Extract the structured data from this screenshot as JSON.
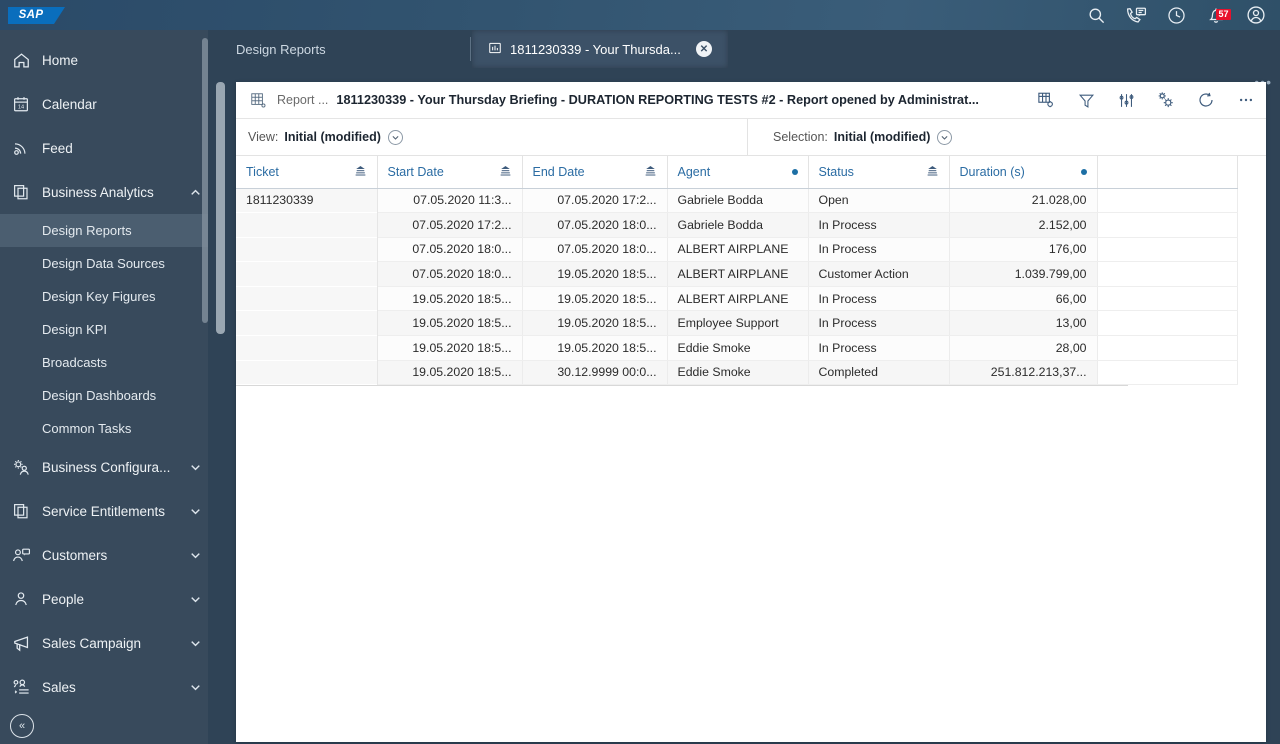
{
  "topbar": {
    "logo": "SAP",
    "icons": [
      {
        "name": "search-icon",
        "label": "Search"
      },
      {
        "name": "phone-chat-icon",
        "label": "Communication"
      },
      {
        "name": "clock-icon",
        "label": "Recent Activity"
      },
      {
        "name": "bell-icon",
        "label": "Notifications",
        "badge": "57"
      },
      {
        "name": "user-avatar-icon",
        "label": "User Menu"
      }
    ]
  },
  "sidebar": {
    "items": [
      {
        "label": "Home",
        "icon": "home-icon",
        "chevron": "",
        "level": "top"
      },
      {
        "label": "Calendar",
        "icon": "calendar-icon",
        "chevron": "",
        "level": "top"
      },
      {
        "label": "Feed",
        "icon": "feed-icon",
        "chevron": "",
        "level": "top"
      },
      {
        "label": "Business Analytics",
        "icon": "copy-layers-icon",
        "chevron": "up",
        "level": "top"
      },
      {
        "label": "Design Reports",
        "icon": "",
        "chevron": "",
        "level": "sub",
        "active": true
      },
      {
        "label": "Design Data Sources",
        "icon": "",
        "chevron": "",
        "level": "sub"
      },
      {
        "label": "Design Key Figures",
        "icon": "",
        "chevron": "",
        "level": "sub"
      },
      {
        "label": "Design KPI",
        "icon": "",
        "chevron": "",
        "level": "sub"
      },
      {
        "label": "Broadcasts",
        "icon": "",
        "chevron": "",
        "level": "sub"
      },
      {
        "label": "Design Dashboards",
        "icon": "",
        "chevron": "",
        "level": "sub"
      },
      {
        "label": "Common Tasks",
        "icon": "",
        "chevron": "",
        "level": "sub"
      },
      {
        "label": "Business Configura...",
        "icon": "config-users-icon",
        "chevron": "down",
        "level": "top"
      },
      {
        "label": "Service Entitlements",
        "icon": "copy-layers-icon",
        "chevron": "down",
        "level": "top"
      },
      {
        "label": "Customers",
        "icon": "customers-icon",
        "chevron": "down",
        "level": "top"
      },
      {
        "label": "People",
        "icon": "person-icon",
        "chevron": "down",
        "level": "top"
      },
      {
        "label": "Sales Campaign",
        "icon": "megaphone-icon",
        "chevron": "down",
        "level": "top"
      },
      {
        "label": "Sales",
        "icon": "sales-list-icon",
        "chevron": "down",
        "level": "top"
      }
    ],
    "collapse_label": "«"
  },
  "tabs": {
    "inactive_label": "Design Reports",
    "active_label": "1811230339 - Your Thursda...",
    "active_icon": "report-chart-icon",
    "close_label": "✕",
    "overflow_label": "•••"
  },
  "report": {
    "icon": "report-grid-icon",
    "prefix": "Report ...",
    "title": "1811230339 - Your Thursday Briefing - DURATION REPORTING TESTS #2 - Report opened by Administrat...",
    "tools": [
      {
        "name": "table-settings-icon",
        "label": "Table Settings"
      },
      {
        "name": "filter-icon",
        "label": "Filter"
      },
      {
        "name": "sliders-icon",
        "label": "Adjust Values"
      },
      {
        "name": "gear-settings-icon",
        "label": "Settings"
      },
      {
        "name": "refresh-icon",
        "label": "Refresh"
      },
      {
        "name": "overflow-menu-icon",
        "label": "More"
      }
    ],
    "view": {
      "label": "View:",
      "value": "Initial (modified)"
    },
    "selection": {
      "label": "Selection:",
      "value": "Initial (modified)"
    }
  },
  "table": {
    "columns": [
      {
        "label": "Ticket",
        "marker": "hierarchy",
        "align": "left"
      },
      {
        "label": "Start Date",
        "marker": "hierarchy",
        "align": "right"
      },
      {
        "label": "End Date",
        "marker": "hierarchy",
        "align": "right"
      },
      {
        "label": "Agent",
        "marker": "dot",
        "align": "left"
      },
      {
        "label": "Status",
        "marker": "hierarchy",
        "align": "left"
      },
      {
        "label": "Duration (s)",
        "marker": "dot",
        "align": "right"
      }
    ],
    "rows": [
      {
        "ticket": "1811230339",
        "start": "07.05.2020 11:3...",
        "end": "07.05.2020 17:2...",
        "agent": "Gabriele Bodda",
        "status": "Open",
        "duration": "21.028,00"
      },
      {
        "ticket": "",
        "start": "07.05.2020 17:2...",
        "end": "07.05.2020 18:0...",
        "agent": "Gabriele Bodda",
        "status": "In Process",
        "duration": "2.152,00"
      },
      {
        "ticket": "",
        "start": "07.05.2020 18:0...",
        "end": "07.05.2020 18:0...",
        "agent": "ALBERT AIRPLANE",
        "status": "In Process",
        "duration": "176,00"
      },
      {
        "ticket": "",
        "start": "07.05.2020 18:0...",
        "end": "19.05.2020 18:5...",
        "agent": "ALBERT AIRPLANE",
        "status": "Customer Action",
        "duration": "1.039.799,00"
      },
      {
        "ticket": "",
        "start": "19.05.2020 18:5...",
        "end": "19.05.2020 18:5...",
        "agent": "ALBERT AIRPLANE",
        "status": "In Process",
        "duration": "66,00"
      },
      {
        "ticket": "",
        "start": "19.05.2020 18:5...",
        "end": "19.05.2020 18:5...",
        "agent": "Employee Support",
        "status": "In Process",
        "duration": "13,00"
      },
      {
        "ticket": "",
        "start": "19.05.2020 18:5...",
        "end": "19.05.2020 18:5...",
        "agent": "Eddie Smoke",
        "status": "In Process",
        "duration": "28,00"
      },
      {
        "ticket": "",
        "start": "19.05.2020 18:5...",
        "end": "30.12.9999 00:0...",
        "agent": "Eddie Smoke",
        "status": "Completed",
        "duration": "251.812.213,37..."
      }
    ]
  },
  "colors": {
    "shell_top": "#31536f",
    "sidebar": "#384a5c",
    "sidebar_active": "#4b5e70",
    "accent_link": "#2b6ca3",
    "badge_red": "#e8112d",
    "sap_blue": "#0a6ebd"
  }
}
